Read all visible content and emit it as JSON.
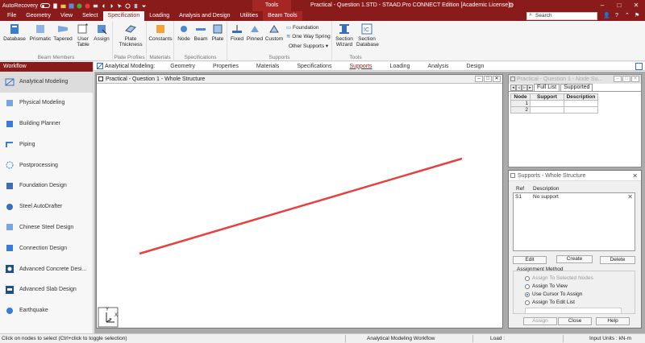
{
  "titlebar": {
    "autorecovery": "AutoRecovery",
    "context_tools": "Tools",
    "title": "Practical - Question 1.STD - STAAD.Pro CONNECT Edition [Academic License]"
  },
  "tabs": [
    "File",
    "Geometry",
    "View",
    "Select",
    "Specification",
    "Loading",
    "Analysis and Design",
    "Utilities",
    "Beam Tools"
  ],
  "active_tab": "Specification",
  "search": {
    "placeholder": "Search"
  },
  "ribbon": {
    "beam_members": {
      "label": "Beam Members",
      "database": "Database",
      "prismatic": "Prismatic",
      "tapered": "Tapered",
      "user_table": "User Table",
      "assign": "Assign"
    },
    "plate_profiles": {
      "label": "Plate Profiles",
      "plate_thickness": "Plate Thickness"
    },
    "materials": {
      "label": "Materials",
      "constants": "Constants"
    },
    "specifications": {
      "label": "Specifications",
      "node": "Node",
      "beam": "Beam",
      "plate": "Plate"
    },
    "supports": {
      "label": "Supports",
      "fixed": "Fixed",
      "pinned": "Pinned",
      "custom": "Custom",
      "foundation": "Foundation",
      "one_way_spring": "One Way Spring",
      "other_supports": "Other Supports"
    },
    "tools": {
      "label": "Tools",
      "section_wizard": "Section Wizard",
      "section_database": "Section Database"
    }
  },
  "sidebar": {
    "header": "Workflow",
    "items": [
      {
        "label": "Analytical Modeling",
        "icon": "analytical-modeling-icon"
      },
      {
        "label": "Physical Modeling",
        "icon": "physical-modeling-icon"
      },
      {
        "label": "Building Planner",
        "icon": "building-planner-icon"
      },
      {
        "label": "Piping",
        "icon": "piping-icon"
      },
      {
        "label": "Postprocessing",
        "icon": "postprocessing-icon"
      },
      {
        "label": "Foundation Design",
        "icon": "foundation-design-icon"
      },
      {
        "label": "Steel AutoDrafter",
        "icon": "steel-autodrafter-icon"
      },
      {
        "label": "Chinese Steel Design",
        "icon": "chinese-steel-design-icon"
      },
      {
        "label": "Connection Design",
        "icon": "connection-design-icon"
      },
      {
        "label": "Advanced Concrete Desi...",
        "icon": "advanced-concrete-icon"
      },
      {
        "label": "Advanced Slab Design",
        "icon": "advanced-slab-icon"
      },
      {
        "label": "Earthquake",
        "icon": "earthquake-icon"
      }
    ]
  },
  "pagebar": {
    "lead": "Analytical Modeling:",
    "items": [
      "Geometry",
      "Properties",
      "Materials",
      "Specifications",
      "Supports",
      "Loading",
      "Analysis",
      "Design"
    ],
    "active": "Supports"
  },
  "view_window": {
    "title": "Practical - Question 1 - Whole Structure",
    "axis_y": "Y",
    "axis_x": "X",
    "axis_z": "Z"
  },
  "node_table": {
    "title": "Practical - Question 1 - Node Su...",
    "tabs": [
      "Full List",
      "Supported"
    ],
    "headers": [
      "Node",
      "Support",
      "Description"
    ],
    "rows": [
      [
        "1",
        "",
        ""
      ],
      [
        "2",
        "",
        ""
      ]
    ]
  },
  "supports_dialog": {
    "title": "Supports - Whole Structure",
    "col_ref": "Ref",
    "col_desc": "Description",
    "rows": [
      {
        "ref": "S1",
        "desc": "No support"
      }
    ],
    "edit": "Edit",
    "create": "Create",
    "delete": "Delete",
    "assignment_label": "Assignment Method",
    "methods": [
      "Assign To Selected Nodes",
      "Assign To View",
      "Use Cursor To Assign",
      "Assign To Edit List"
    ],
    "selected_method": "Use Cursor To Assign",
    "assign": "Assign",
    "close": "Close",
    "help": "Help"
  },
  "statusbar": {
    "hint": "Click on nodes to select (Ctrl+click to toggle selection)",
    "workflow": "Analytical Modeling Workflow",
    "load": "Load :",
    "units": "Input Units : kN-m"
  },
  "colors": {
    "brand": "#8a1b1b",
    "member_line": "#e8403f"
  }
}
